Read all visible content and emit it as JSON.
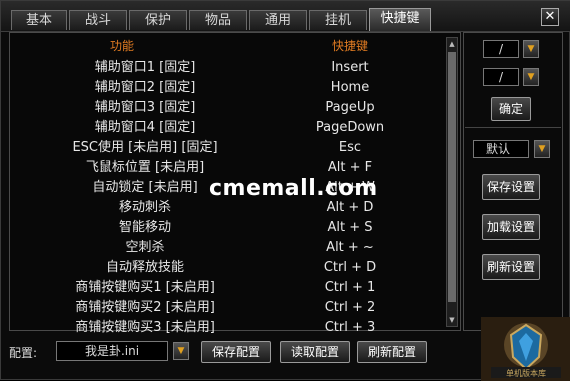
{
  "tabs": [
    {
      "label": "基本",
      "active": false
    },
    {
      "label": "战斗",
      "active": false
    },
    {
      "label": "保护",
      "active": false
    },
    {
      "label": "物品",
      "active": false
    },
    {
      "label": "通用",
      "active": false
    },
    {
      "label": "挂机",
      "active": false
    },
    {
      "label": "快捷键",
      "active": true
    }
  ],
  "close_label": "✕",
  "list": {
    "header_func": "功能",
    "header_key": "快捷键",
    "rows": [
      {
        "func": "辅助窗口1 [固定]",
        "key": "Insert"
      },
      {
        "func": "辅助窗口2 [固定]",
        "key": "Home"
      },
      {
        "func": "辅助窗口3 [固定]",
        "key": "PageUp"
      },
      {
        "func": "辅助窗口4 [固定]",
        "key": "PageDown"
      },
      {
        "func": "ESC使用 [未启用] [固定]",
        "key": "Esc"
      },
      {
        "func": "飞鼠标位置 [未启用]",
        "key": "Alt + F"
      },
      {
        "func": "自动锁定 [未启用]",
        "key": "Alt + W"
      },
      {
        "func": "移动刺杀",
        "key": "Alt + D"
      },
      {
        "func": "智能移动",
        "key": "Alt + S"
      },
      {
        "func": "空刺杀",
        "key": "Alt + ~"
      },
      {
        "func": "自动释放技能",
        "key": "Ctrl + D"
      },
      {
        "func": "商铺按键购买1 [未启用]",
        "key": "Ctrl + 1"
      },
      {
        "func": "商铺按键购买2 [未启用]",
        "key": "Ctrl + 2"
      },
      {
        "func": "商铺按键购买3 [未启用]",
        "key": "Ctrl + 3"
      }
    ]
  },
  "side": {
    "key_mod_value": "/",
    "key_char_value": "/",
    "confirm_label": "确定",
    "profile_value": "默认",
    "save_settings": "保存设置",
    "load_settings": "加载设置",
    "refresh_settings": "刷新设置"
  },
  "bottom": {
    "config_label": "配置:",
    "config_file": "我是卦.ini",
    "save_config": "保存配置",
    "read_config": "读取配置",
    "refresh_config": "刷新配置"
  },
  "watermark": "cmemall.com",
  "logo_text": "单机版本库"
}
